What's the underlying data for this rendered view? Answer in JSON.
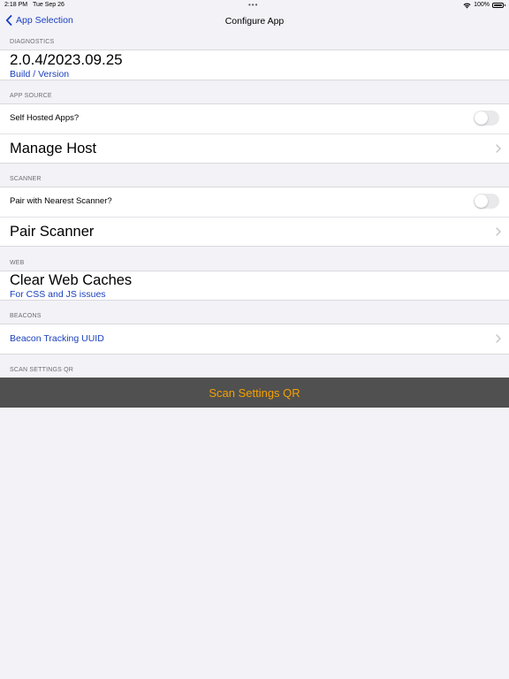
{
  "status_bar": {
    "time": "2:18 PM",
    "date": "Tue Sep 26",
    "dots": "•••",
    "battery": "100%",
    "icons": [
      "wifi-icon",
      "battery-icon"
    ]
  },
  "nav": {
    "back_label": "App Selection",
    "back_icon": "chevron-left-icon",
    "title": "Configure App",
    "accent_color": "#1a3fbf"
  },
  "sections": {
    "diagnostics": {
      "header": "DIAGNOSTICS",
      "version": "2.0.4/2023.09.25",
      "version_caption": "Build / Version"
    },
    "app_source": {
      "header": "APP SOURCE",
      "self_hosted_label": "Self Hosted Apps?",
      "self_hosted_on": false,
      "manage_host_label": "Manage Host"
    },
    "scanner": {
      "header": "SCANNER",
      "pair_nearest_label": "Pair with Nearest Scanner?",
      "pair_nearest_on": false,
      "pair_scanner_label": "Pair Scanner"
    },
    "web": {
      "header": "WEB",
      "clear_caches_label": "Clear Web Caches",
      "clear_caches_caption": "For CSS and JS issues"
    },
    "beacons": {
      "header": "BEACONS",
      "beacon_uuid_label": "Beacon Tracking UUID"
    },
    "scan_settings": {
      "header": "SCAN SETTINGS QR",
      "button_label": "Scan Settings QR",
      "button_bg": "#505050",
      "button_text_color": "#f5a000"
    }
  }
}
